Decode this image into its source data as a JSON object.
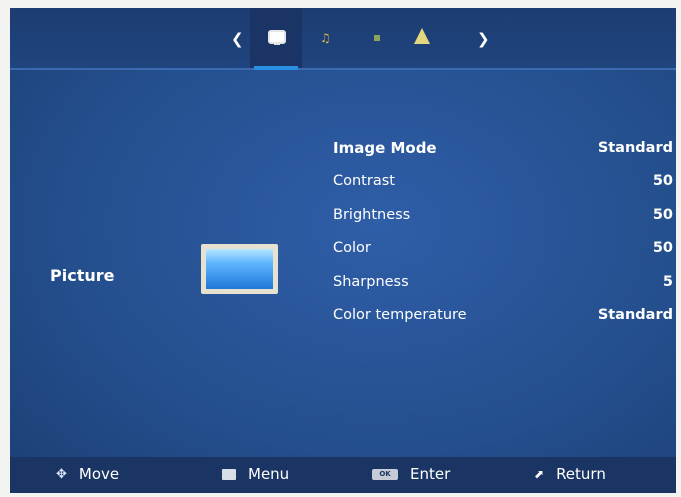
{
  "top_tabs": {
    "prev_icon": "chevron-left-icon",
    "next_icon": "chevron-right-icon",
    "items": [
      {
        "name": "picture-tab",
        "icon": "tv-icon",
        "selected": true
      },
      {
        "name": "sound-tab",
        "icon": "music-note-icon",
        "selected": false
      },
      {
        "name": "setup-tab",
        "icon": "square-icon",
        "selected": false
      },
      {
        "name": "lock-tab",
        "icon": "bell-icon",
        "selected": false
      }
    ]
  },
  "section": {
    "label": "Picture"
  },
  "settings": [
    {
      "label": "Image Mode",
      "value": "Standard"
    },
    {
      "label": "Contrast",
      "value": "50"
    },
    {
      "label": "Brightness",
      "value": "50"
    },
    {
      "label": "Color",
      "value": "50"
    },
    {
      "label": "Sharpness",
      "value": "5"
    },
    {
      "label": "Color temperature",
      "value": "Standard"
    }
  ],
  "bottom_hints": {
    "move": "Move",
    "menu": "Menu",
    "enter": "Enter",
    "enter_key": "OK",
    "return": "Return"
  },
  "colors": {
    "background": "#25508f",
    "topbar": "#1d3c72",
    "accent": "#2a8fe0"
  }
}
